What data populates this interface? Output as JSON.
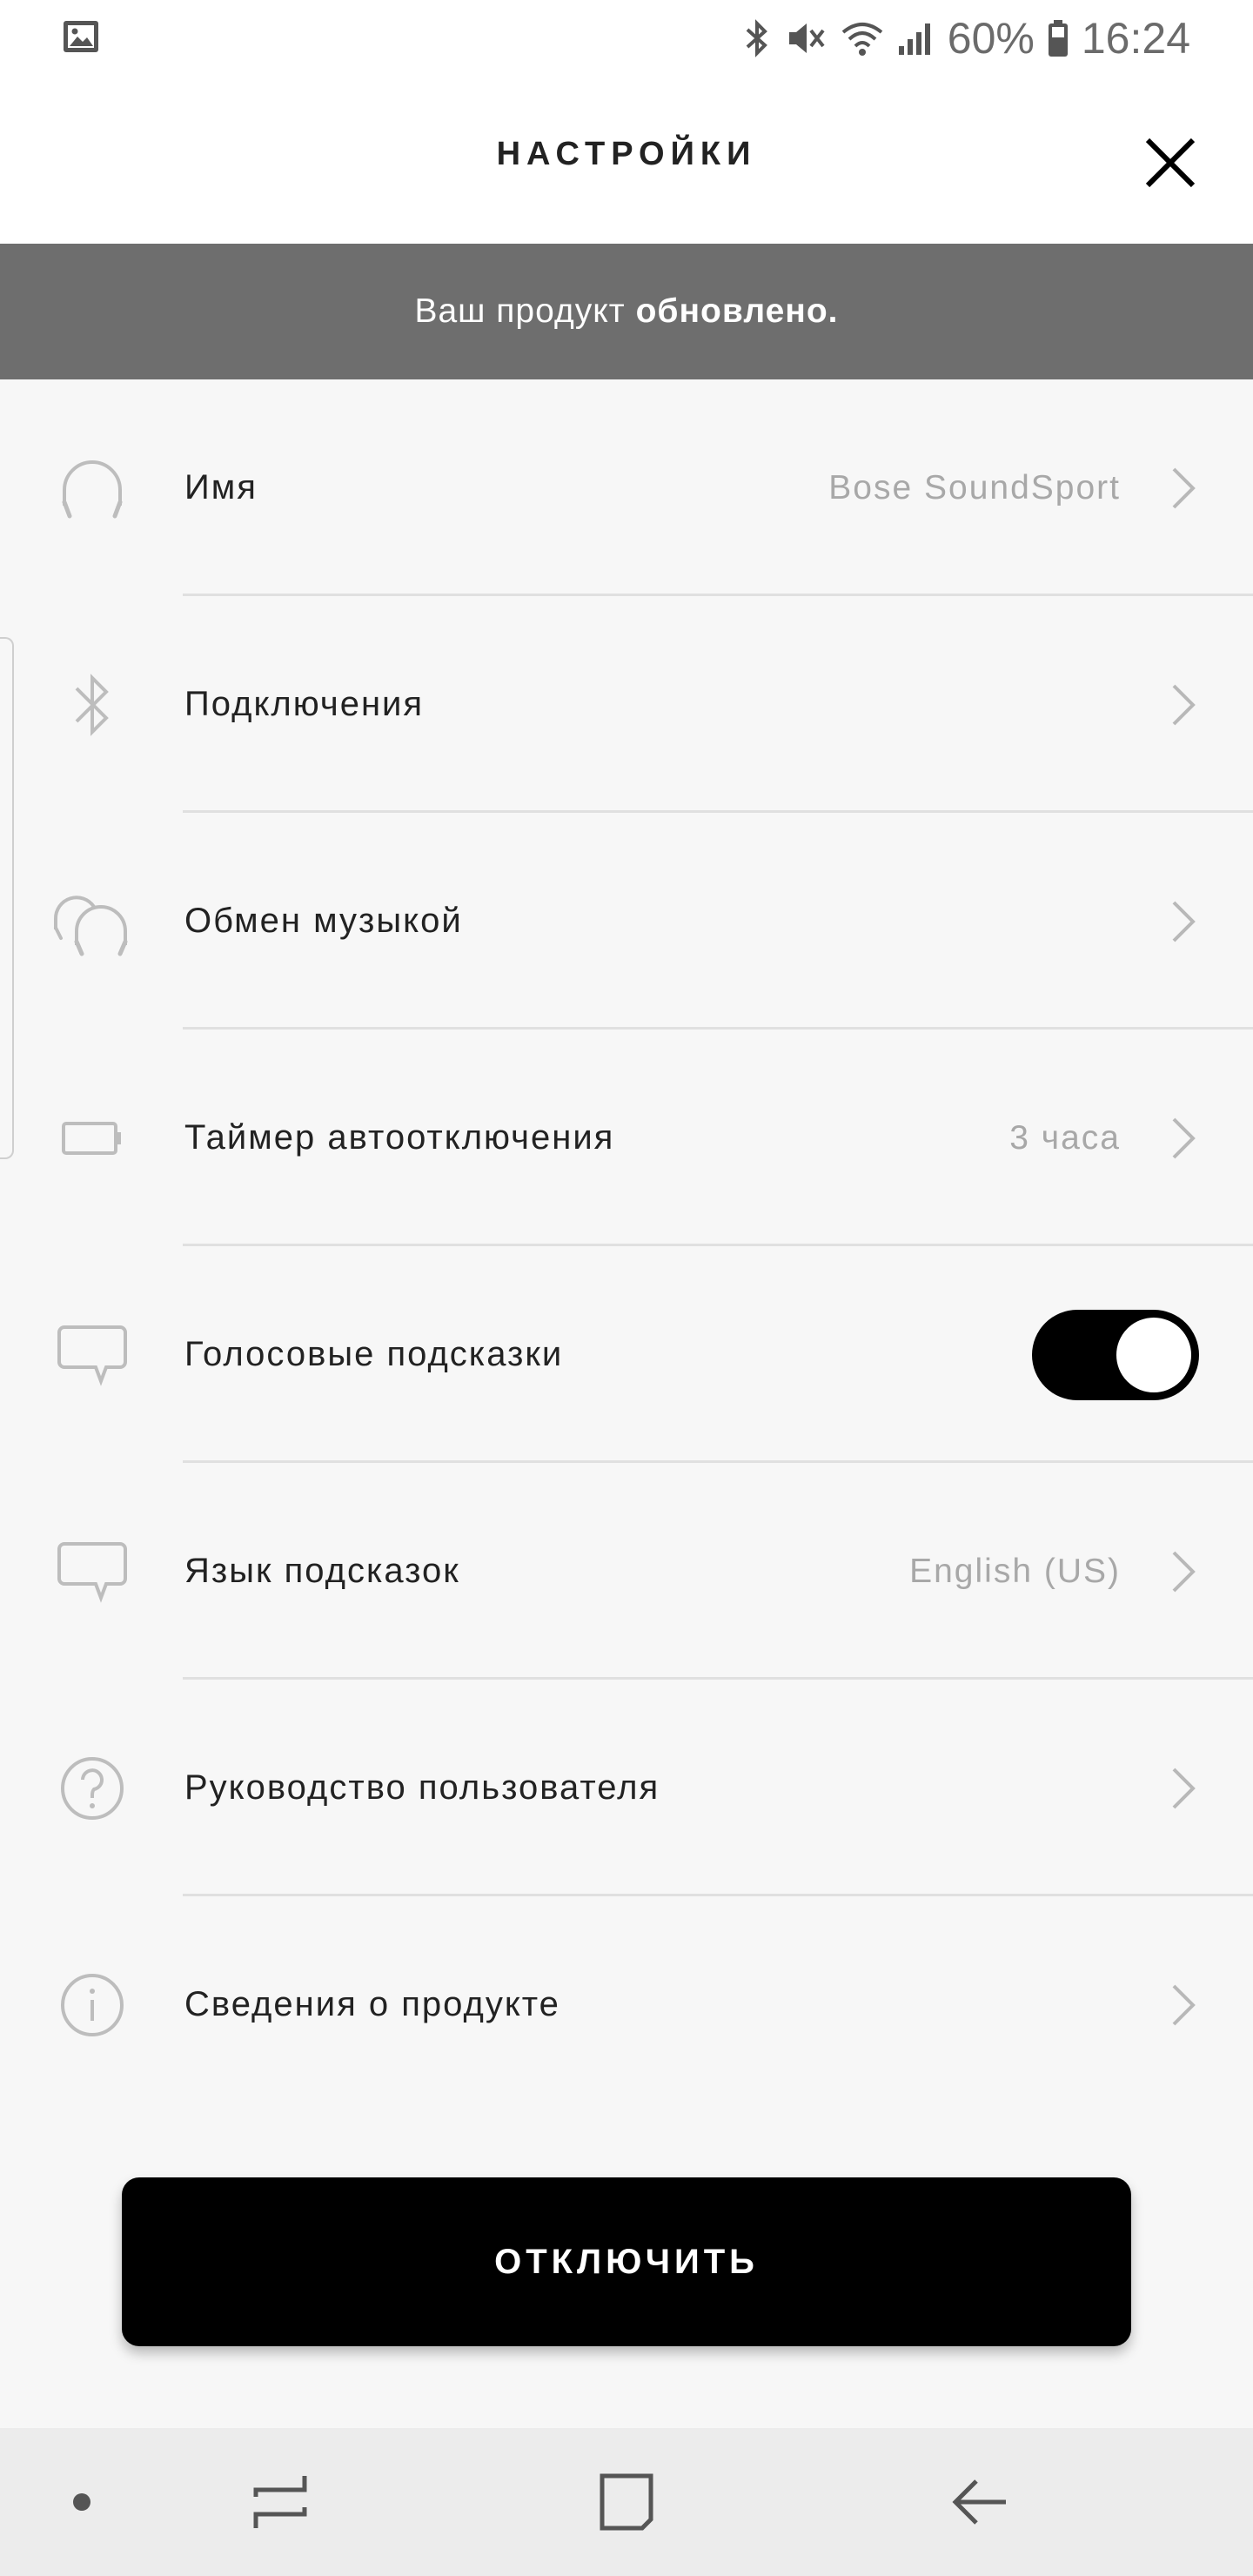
{
  "status_bar": {
    "battery_percent": "60%",
    "time": "16:24",
    "icons": [
      "gallery-icon",
      "bluetooth-icon",
      "mute-icon",
      "wifi-icon",
      "signal-icon",
      "battery-icon"
    ]
  },
  "header": {
    "title": "НАСТРОЙКИ",
    "close_icon": "close-icon"
  },
  "banner": {
    "text_prefix": "Ваш продукт",
    "text_bold": "обновлено."
  },
  "settings": {
    "rows": [
      {
        "label": "Имя",
        "value": "Bose SoundSport",
        "icon": "headphones-icon"
      },
      {
        "label": "Подключения",
        "value": "",
        "icon": "bluetooth-icon"
      },
      {
        "label": "Обмен музыкой",
        "value": "",
        "icon": "music-share-icon"
      },
      {
        "label": "Таймер автоотключения",
        "value": "3 часа",
        "icon": "battery-icon"
      },
      {
        "label": "Голосовые подсказки",
        "toggle_on": true,
        "icon": "speech-bubble-icon"
      },
      {
        "label": "Язык подсказок",
        "value": "English (US)",
        "icon": "speech-bubble-icon"
      },
      {
        "label": "Руководство пользователя",
        "value": "",
        "icon": "help-icon"
      },
      {
        "label": "Сведения о продукте",
        "value": "",
        "icon": "info-icon"
      }
    ]
  },
  "disconnect_button": {
    "label": "ОТКЛЮЧИТЬ"
  },
  "colors": {
    "banner_bg": "#6e6e6e",
    "button_bg": "#000000",
    "icon_gray": "#bdbdbd",
    "value_gray": "#a8a8a8"
  }
}
